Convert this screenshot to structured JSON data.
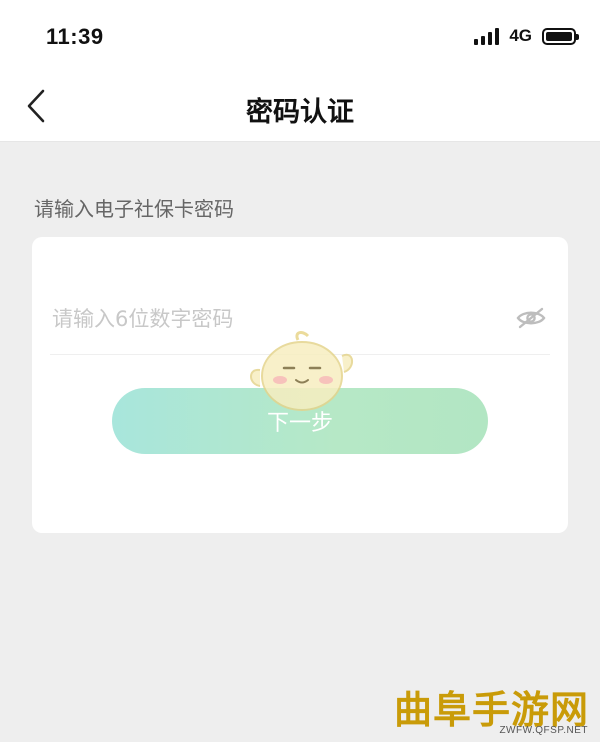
{
  "status_bar": {
    "time": "11:39",
    "network": "4G"
  },
  "nav": {
    "back_icon": "chevron-left-icon",
    "title": "密码认证"
  },
  "form": {
    "hint": "请输入电子社保卡密码",
    "password_placeholder": "请输入6位数字密码",
    "password_value": "",
    "visibility_icon": "eye-off-icon",
    "next_label": "下一步"
  },
  "watermark": {
    "title": "曲阜手游网",
    "url": "ZWFW.QFSP.NET"
  },
  "colors": {
    "button_gradient_start": "#a8e6dc",
    "button_gradient_end": "#b2e6c3",
    "background": "#eeeeee",
    "watermark_gold": "#c99b08"
  }
}
